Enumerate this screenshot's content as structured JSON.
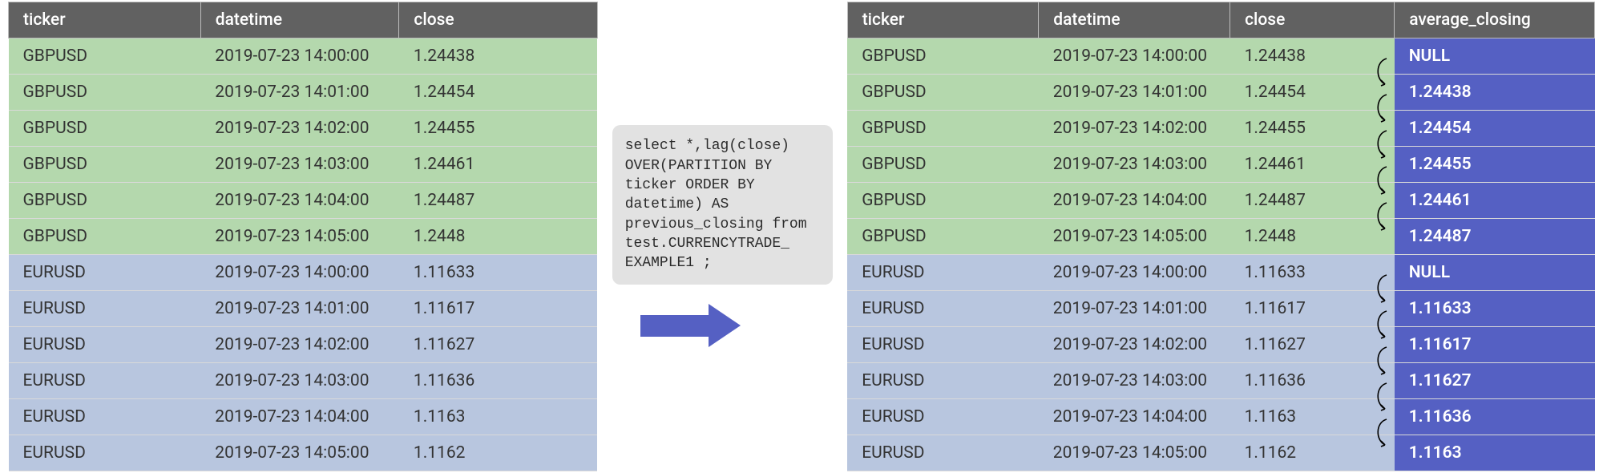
{
  "columns": {
    "ticker": "ticker",
    "datetime": "datetime",
    "close": "close",
    "avg": "average_closing"
  },
  "sql": "select *,lag(close)\nOVER(PARTITION BY\nticker ORDER BY\ndatetime) AS\nprevious_closing from\ntest.CURRENCYTRADE_\nEXAMPLE1 ;",
  "rows": [
    {
      "group": "green",
      "ticker": "GBPUSD",
      "datetime": "2019-07-23 14:00:00",
      "close": "1.24438",
      "avg": "NULL"
    },
    {
      "group": "green",
      "ticker": "GBPUSD",
      "datetime": "2019-07-23 14:01:00",
      "close": "1.24454",
      "avg": "1.24438"
    },
    {
      "group": "green",
      "ticker": "GBPUSD",
      "datetime": "2019-07-23 14:02:00",
      "close": "1.24455",
      "avg": "1.24454"
    },
    {
      "group": "green",
      "ticker": "GBPUSD",
      "datetime": "2019-07-23 14:03:00",
      "close": "1.24461",
      "avg": "1.24455"
    },
    {
      "group": "green",
      "ticker": "GBPUSD",
      "datetime": "2019-07-23 14:04:00",
      "close": "1.24487",
      "avg": "1.24461"
    },
    {
      "group": "green",
      "ticker": "GBPUSD",
      "datetime": "2019-07-23 14:05:00",
      "close": "1.2448",
      "avg": "1.24487"
    },
    {
      "group": "blue",
      "ticker": "EURUSD",
      "datetime": "2019-07-23 14:00:00",
      "close": "1.11633",
      "avg": "NULL"
    },
    {
      "group": "blue",
      "ticker": "EURUSD",
      "datetime": "2019-07-23 14:01:00",
      "close": "1.11617",
      "avg": "1.11633"
    },
    {
      "group": "blue",
      "ticker": "EURUSD",
      "datetime": "2019-07-23 14:02:00",
      "close": "1.11627",
      "avg": "1.11617"
    },
    {
      "group": "blue",
      "ticker": "EURUSD",
      "datetime": "2019-07-23 14:03:00",
      "close": "1.11636",
      "avg": "1.11627"
    },
    {
      "group": "blue",
      "ticker": "EURUSD",
      "datetime": "2019-07-23 14:04:00",
      "close": "1.1163",
      "avg": "1.11636"
    },
    {
      "group": "blue",
      "ticker": "EURUSD",
      "datetime": "2019-07-23 14:05:00",
      "close": "1.1162",
      "avg": "1.1163"
    }
  ]
}
